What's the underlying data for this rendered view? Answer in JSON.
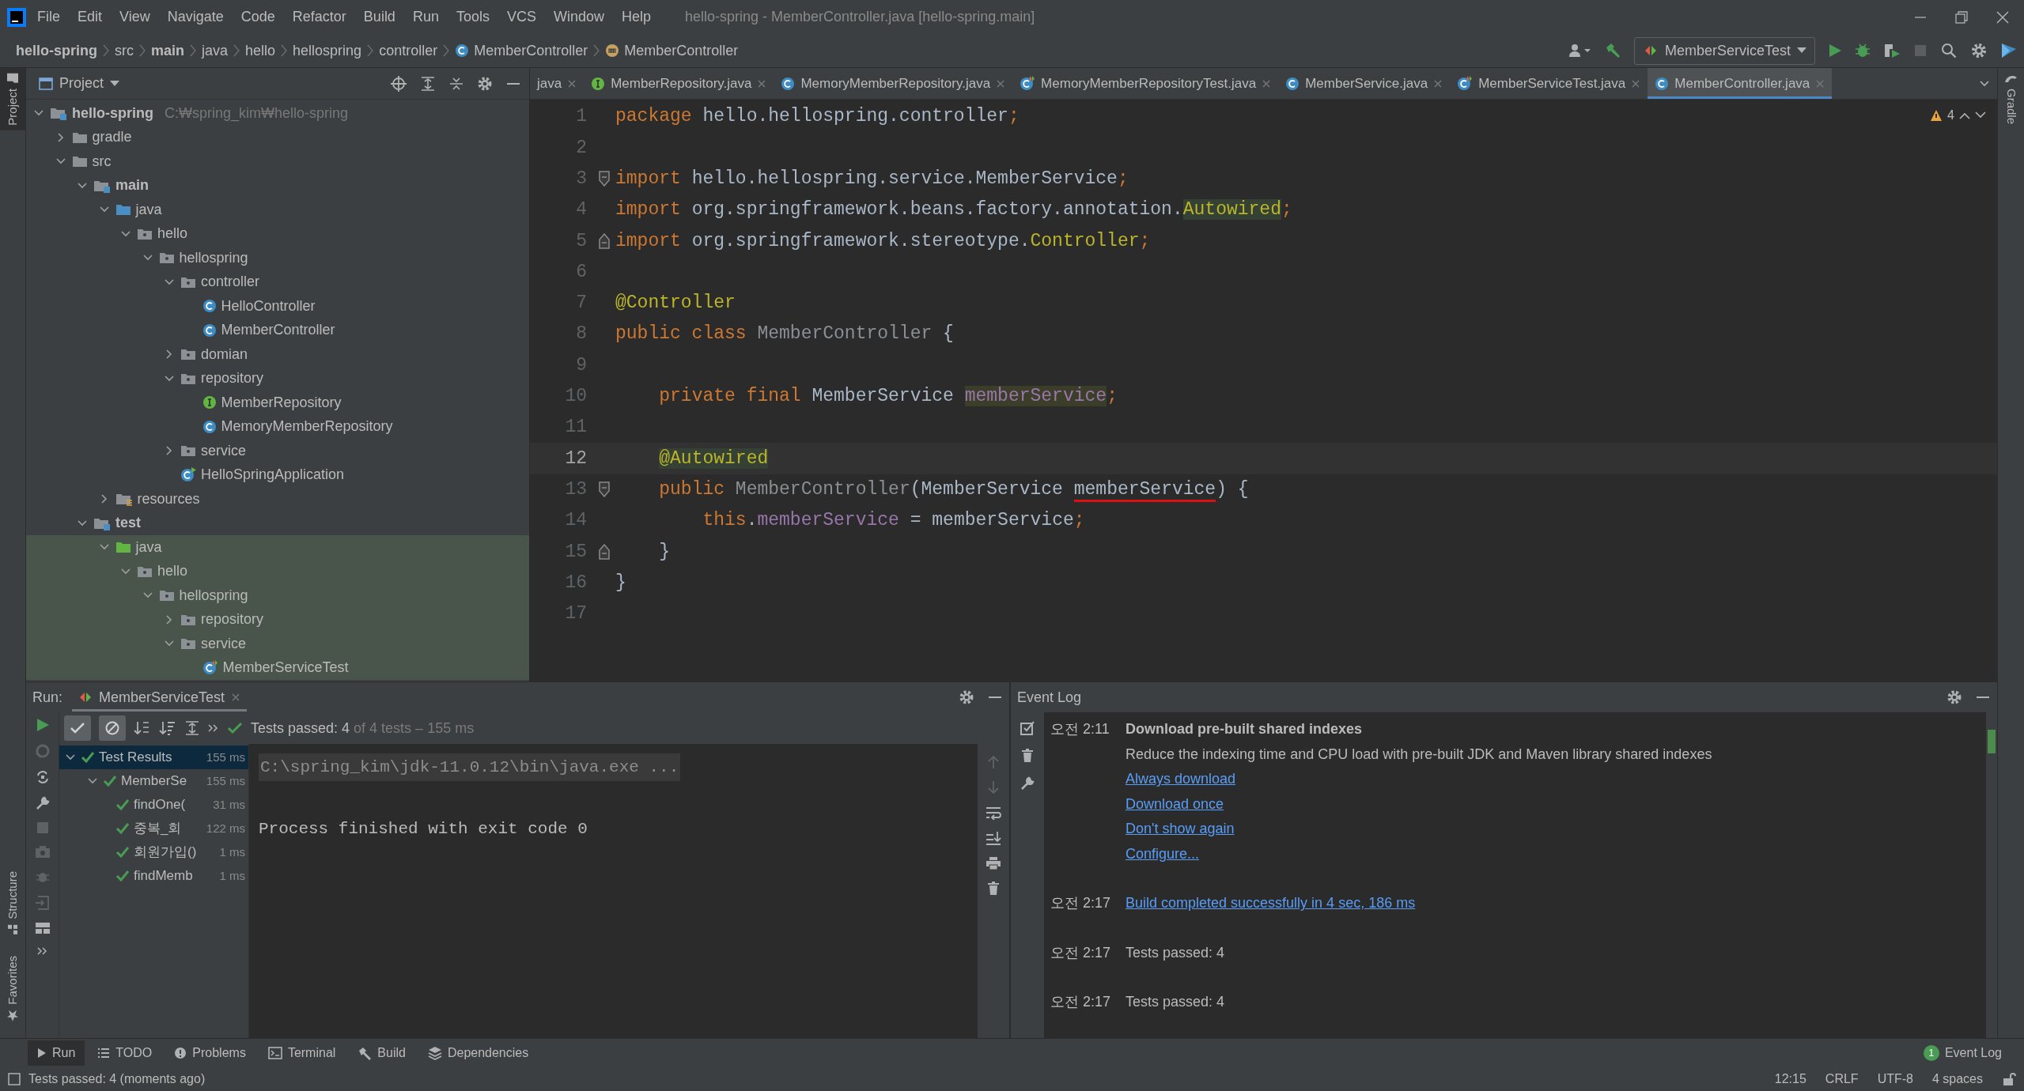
{
  "menu_bar": {
    "items": [
      "File",
      "Edit",
      "View",
      "Navigate",
      "Code",
      "Refactor",
      "Build",
      "Run",
      "Tools",
      "VCS",
      "Window",
      "Help"
    ],
    "title": "hello-spring - MemberController.java [hello-spring.main]"
  },
  "breadcrumbs": [
    {
      "label": "hello-spring",
      "bold": true,
      "kind": "path"
    },
    {
      "label": "src",
      "bold": false,
      "kind": "path"
    },
    {
      "label": "main",
      "bold": true,
      "kind": "path"
    },
    {
      "label": "java",
      "bold": false,
      "kind": "path"
    },
    {
      "label": "hello",
      "bold": false,
      "kind": "path"
    },
    {
      "label": "hellospring",
      "bold": false,
      "kind": "path"
    },
    {
      "label": "controller",
      "bold": false,
      "kind": "path"
    },
    {
      "label": "MemberController",
      "bold": false,
      "kind": "class"
    },
    {
      "label": "MemberController",
      "bold": false,
      "kind": "method"
    }
  ],
  "toolbar": {
    "run_config": "MemberServiceTest"
  },
  "side_stripes": {
    "left_top": {
      "label": "Project",
      "selected": true
    },
    "left_bottom": [
      {
        "label": "Structure",
        "selected": false
      },
      {
        "label": "Favorites",
        "selected": false
      }
    ],
    "right": {
      "label": "Gradle",
      "selected": false
    }
  },
  "project": {
    "title": "Project",
    "tree": [
      {
        "label": "hello-spring",
        "path": "C:₩spring_kim₩hello-spring",
        "bold": true,
        "kind": "module",
        "expanded": true,
        "tinted": false,
        "children": [
          {
            "label": "gradle",
            "bold": false,
            "kind": "folder",
            "expanded": false,
            "tinted": false
          },
          {
            "label": "src",
            "bold": false,
            "kind": "folder",
            "expanded": true,
            "tinted": false,
            "children": [
              {
                "label": "main",
                "bold": true,
                "kind": "module",
                "expanded": true,
                "tinted": false,
                "children": [
                  {
                    "label": "java",
                    "bold": false,
                    "kind": "source",
                    "expanded": true,
                    "tinted": false,
                    "children": [
                      {
                        "label": "hello",
                        "bold": false,
                        "kind": "package",
                        "expanded": true,
                        "tinted": false,
                        "children": [
                          {
                            "label": "hellospring",
                            "bold": false,
                            "kind": "package",
                            "expanded": true,
                            "tinted": false,
                            "children": [
                              {
                                "label": "controller",
                                "bold": false,
                                "kind": "package",
                                "expanded": true,
                                "tinted": false,
                                "children": [
                                  {
                                    "label": "HelloController",
                                    "bold": false,
                                    "kind": "class",
                                    "tinted": false
                                  },
                                  {
                                    "label": "MemberController",
                                    "bold": false,
                                    "kind": "class",
                                    "tinted": false
                                  }
                                ]
                              },
                              {
                                "label": "domian",
                                "bold": false,
                                "kind": "package",
                                "expanded": false,
                                "tinted": false
                              },
                              {
                                "label": "repository",
                                "bold": false,
                                "kind": "package",
                                "expanded": true,
                                "tinted": false,
                                "children": [
                                  {
                                    "label": "MemberRepository",
                                    "bold": false,
                                    "kind": "interface",
                                    "tinted": false
                                  },
                                  {
                                    "label": "MemoryMemberRepository",
                                    "bold": false,
                                    "kind": "class",
                                    "tinted": false
                                  }
                                ]
                              },
                              {
                                "label": "service",
                                "bold": false,
                                "kind": "package",
                                "expanded": false,
                                "tinted": false
                              },
                              {
                                "label": "HelloSpringApplication",
                                "bold": false,
                                "kind": "app-class",
                                "tinted": false
                              }
                            ]
                          }
                        ]
                      }
                    ]
                  },
                  {
                    "label": "resources",
                    "bold": false,
                    "kind": "resources",
                    "expanded": false,
                    "tinted": false
                  }
                ]
              },
              {
                "label": "test",
                "bold": true,
                "kind": "module",
                "expanded": true,
                "tinted": false,
                "children": [
                  {
                    "label": "java",
                    "bold": false,
                    "kind": "test-source",
                    "expanded": true,
                    "tinted": true,
                    "children": [
                      {
                        "label": "hello",
                        "bold": false,
                        "kind": "package",
                        "expanded": true,
                        "tinted": true,
                        "children": [
                          {
                            "label": "hellospring",
                            "bold": false,
                            "kind": "package",
                            "expanded": true,
                            "tinted": true,
                            "children": [
                              {
                                "label": "repository",
                                "bold": false,
                                "kind": "package",
                                "expanded": false,
                                "tinted": true
                              },
                              {
                                "label": "service",
                                "bold": false,
                                "kind": "package",
                                "expanded": true,
                                "tinted": true,
                                "children": [
                                  {
                                    "label": "MemberServiceTest",
                                    "bold": false,
                                    "kind": "test-class",
                                    "tinted": true
                                  }
                                ]
                              }
                            ]
                          }
                        ]
                      }
                    ]
                  }
                ]
              }
            ]
          }
        ]
      }
    ]
  },
  "editor": {
    "tabs": [
      {
        "label": "java",
        "kind": "plain",
        "selected": false
      },
      {
        "label": "MemberRepository.java",
        "kind": "interface",
        "selected": false
      },
      {
        "label": "MemoryMemberRepository.java",
        "kind": "class",
        "selected": false
      },
      {
        "label": "MemoryMemberRepositoryTest.java",
        "kind": "test-class",
        "selected": false
      },
      {
        "label": "MemberService.java",
        "kind": "class",
        "selected": false
      },
      {
        "label": "MemberServiceTest.java",
        "kind": "test-class",
        "selected": false
      },
      {
        "label": "MemberController.java",
        "kind": "class",
        "selected": true
      }
    ],
    "warnings": "4",
    "lines": [
      {
        "number": "1",
        "current": false,
        "fold_start": false,
        "fold_end": false,
        "tokens": [
          {
            "text": "package ",
            "kind": "keyword"
          },
          {
            "text": "hello.hellospring.controller",
            "kind": "plain"
          },
          {
            "text": ";",
            "kind": "keyword"
          }
        ]
      },
      {
        "number": "2",
        "current": false,
        "fold_start": false,
        "fold_end": false
      },
      {
        "number": "3",
        "current": false,
        "fold_start": true,
        "fold_end": false,
        "tokens": [
          {
            "text": "import ",
            "kind": "keyword"
          },
          {
            "text": "hello.hellospring.service.MemberService",
            "kind": "plain"
          },
          {
            "text": ";",
            "kind": "keyword"
          }
        ]
      },
      {
        "number": "4",
        "current": false,
        "fold_start": false,
        "fold_end": false,
        "tokens": [
          {
            "text": "import ",
            "kind": "keyword"
          },
          {
            "text": "org.springframework.beans.factory.annotation.",
            "kind": "plain"
          },
          {
            "text": "Autowired",
            "kind": "marked"
          },
          {
            "text": ";",
            "kind": "keyword"
          }
        ]
      },
      {
        "number": "5",
        "current": false,
        "fold_start": false,
        "fold_end": true,
        "tokens": [
          {
            "text": "import ",
            "kind": "keyword"
          },
          {
            "text": "org.springframework.stereotype.",
            "kind": "plain"
          },
          {
            "text": "Controller",
            "kind": "annotation"
          },
          {
            "text": ";",
            "kind": "keyword"
          }
        ]
      },
      {
        "number": "6",
        "current": false,
        "fold_start": false,
        "fold_end": false
      },
      {
        "number": "7",
        "current": false,
        "fold_start": false,
        "fold_end": false,
        "tokens": [
          {
            "text": "@Controller",
            "kind": "annotation"
          }
        ]
      },
      {
        "number": "8",
        "current": false,
        "fold_start": false,
        "fold_end": false,
        "tokens": [
          {
            "text": "public class ",
            "kind": "keyword"
          },
          {
            "text": "MemberController",
            "kind": "muted"
          },
          {
            "text": " {",
            "kind": "plain"
          }
        ]
      },
      {
        "number": "9",
        "current": false,
        "fold_start": false,
        "fold_end": false
      },
      {
        "number": "10",
        "current": false,
        "fold_start": false,
        "fold_end": false,
        "tokens": [
          {
            "text": "    private final ",
            "kind": "keyword"
          },
          {
            "text": "MemberService ",
            "kind": "plain"
          },
          {
            "text": "memberService",
            "kind": "field-marked"
          },
          {
            "text": ";",
            "kind": "keyword"
          }
        ]
      },
      {
        "number": "11",
        "current": false,
        "fold_start": false,
        "fold_end": false
      },
      {
        "number": "12",
        "current": true,
        "fold_start": false,
        "fold_end": false,
        "tokens": [
          {
            "text": "    @Autowired",
            "kind": "marked"
          }
        ]
      },
      {
        "number": "13",
        "current": false,
        "fold_start": true,
        "fold_end": false,
        "tokens": [
          {
            "text": "    public ",
            "kind": "keyword"
          },
          {
            "text": "MemberController",
            "kind": "muted"
          },
          {
            "text": "(MemberService ",
            "kind": "plain"
          },
          {
            "text": "memberService",
            "kind": "error"
          },
          {
            "text": ") {",
            "kind": "plain"
          }
        ]
      },
      {
        "number": "14",
        "current": false,
        "fold_start": false,
        "fold_end": false,
        "tokens": [
          {
            "text": "        this",
            "kind": "keyword"
          },
          {
            "text": ".",
            "kind": "plain"
          },
          {
            "text": "memberService",
            "kind": "field"
          },
          {
            "text": " = memberService",
            "kind": "plain"
          },
          {
            "text": ";",
            "kind": "keyword"
          }
        ]
      },
      {
        "number": "15",
        "current": false,
        "fold_start": false,
        "fold_end": true,
        "tokens": [
          {
            "text": "    }",
            "kind": "plain"
          }
        ]
      },
      {
        "number": "16",
        "current": false,
        "fold_start": false,
        "fold_end": false,
        "tokens": [
          {
            "text": "}",
            "kind": "plain"
          }
        ]
      },
      {
        "number": "17",
        "current": false,
        "fold_start": false,
        "fold_end": false
      }
    ]
  },
  "run_panel": {
    "label": "Run:",
    "tab": "MemberServiceTest",
    "toggles": [
      {
        "kind": "passed",
        "pressed": true
      },
      {
        "kind": "ignored",
        "pressed": true
      }
    ],
    "summary": {
      "passed": "Tests passed: 4",
      "detail": "of 4 tests – 155 ms"
    },
    "results": [
      {
        "label": "Test Results",
        "time": "155 ms",
        "expanded": true,
        "selected": true,
        "children": [
          {
            "label": "MemberSe",
            "time": "155 ms",
            "expanded": true,
            "selected": false,
            "children": [
              {
                "label": "findOne(",
                "time": "31 ms",
                "selected": false
              },
              {
                "label": "중복_회",
                "time": "122 ms",
                "selected": false
              },
              {
                "label": "회원가입()",
                "time": "1 ms",
                "selected": false
              },
              {
                "label": "findMemb",
                "time": "1 ms",
                "selected": false
              }
            ]
          }
        ]
      }
    ],
    "console": [
      {
        "text": "C:\\spring_kim\\jdk-11.0.12\\bin\\java.exe ...",
        "kind": "command"
      },
      {
        "text": "Process finished with exit code 0",
        "kind": "output"
      }
    ]
  },
  "event_log": {
    "title": "Event Log",
    "entries": [
      {
        "time": "오전 2:11",
        "lines": [
          {
            "text": "Download pre-built shared indexes",
            "kind": "title"
          },
          {
            "text": "Reduce the indexing time and CPU load with pre-built JDK and Maven library shared indexes",
            "kind": "text"
          },
          {
            "text": "Always download",
            "kind": "link"
          },
          {
            "text": "Download once",
            "kind": "link"
          },
          {
            "text": "Don't show again",
            "kind": "link"
          },
          {
            "text": "Configure...",
            "kind": "link"
          }
        ]
      },
      {
        "time": "오전 2:17",
        "lines": [
          {
            "text": "Build completed successfully in 4 sec, 186 ms",
            "kind": "link"
          }
        ]
      },
      {
        "time": "오전 2:17",
        "lines": [
          {
            "text": "Tests passed: 4",
            "kind": "text"
          }
        ]
      },
      {
        "time": "오전 2:17",
        "lines": [
          {
            "text": "Tests passed: 4",
            "kind": "text"
          }
        ]
      }
    ]
  },
  "tool_tabs": [
    {
      "label": "Run",
      "kind": "run",
      "selected": true
    },
    {
      "label": "TODO",
      "kind": "list",
      "selected": false
    },
    {
      "label": "Problems",
      "kind": "info",
      "selected": false
    },
    {
      "label": "Terminal",
      "kind": "terminal",
      "selected": false
    },
    {
      "label": "Build",
      "kind": "hammer",
      "selected": false
    },
    {
      "label": "Dependencies",
      "kind": "layers",
      "selected": false
    }
  ],
  "event_log_button": {
    "count": "1",
    "label": "Event Log"
  },
  "status_bar": {
    "message": "Tests passed: 4 (moments ago)",
    "items": [
      "12:15",
      "CRLF",
      "UTF-8",
      "4 spaces"
    ]
  }
}
